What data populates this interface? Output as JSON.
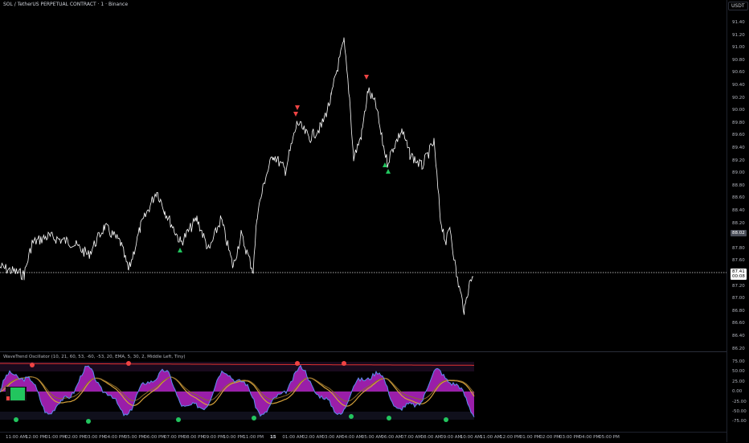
{
  "header": {
    "symbol_title": "SOL / TetherUS PERPETUAL CONTRACT · 1 · Binance",
    "currency": "USDT"
  },
  "price_axis": {
    "labels": [
      "91.40",
      "91.20",
      "91.00",
      "90.80",
      "90.60",
      "90.40",
      "90.20",
      "90.00",
      "89.80",
      "89.60",
      "89.40",
      "89.20",
      "89.00",
      "88.80",
      "88.60",
      "88.40",
      "88.20",
      "88.00",
      "87.80",
      "87.60",
      "87.40",
      "87.20",
      "87.00",
      "86.80",
      "86.60",
      "86.40",
      "86.20"
    ],
    "last_price": "88.02",
    "current_price": "87.41",
    "countdown": "00:08"
  },
  "oscillator": {
    "label": "WaveTrend Oscillator (10, 21, 60, 53, -60, -53, 20, EMA, 5, 30, 2, Middle Left, Tiny)",
    "axis_labels": [
      "75.00",
      "50.00",
      "25.00",
      "0.00",
      "-25.00",
      "-50.00",
      "-75.00"
    ],
    "table_cells": [
      "",
      "",
      "",
      "",
      ""
    ]
  },
  "time_axis": {
    "labels": [
      "11:00 AM",
      "12:00 PM",
      "01:00 PM",
      "02:00 PM",
      "03:00 PM",
      "04:00 PM",
      "05:00 PM",
      "06:00 PM",
      "07:00 PM",
      "08:00 PM",
      "09:00 PM",
      "10:00 PM",
      "11:00 PM",
      "15",
      "01:00 AM",
      "02:00 AM",
      "03:00 AM",
      "04:00 AM",
      "05:00 AM",
      "06:00 AM",
      "07:00 AM",
      "08:00 AM",
      "09:00 AM",
      "10:00 AM",
      "11:00 AM",
      "12:00 PM",
      "01:00 PM",
      "02:00 PM",
      "03:00 PM",
      "04:00 PM",
      "05:00 PM"
    ]
  },
  "colors": {
    "background": "#000000",
    "price_line": "#ffffff",
    "buy_signal": "#22c55e",
    "sell_signal": "#ef4444",
    "wt_line": "#5b8def",
    "wt_fill": "#c026d3",
    "slow_line": "#d6a23a",
    "trend_line": "#e03030"
  },
  "icons": {
    "buy_marker": "triangle-up",
    "sell_marker": "triangle-down"
  }
}
